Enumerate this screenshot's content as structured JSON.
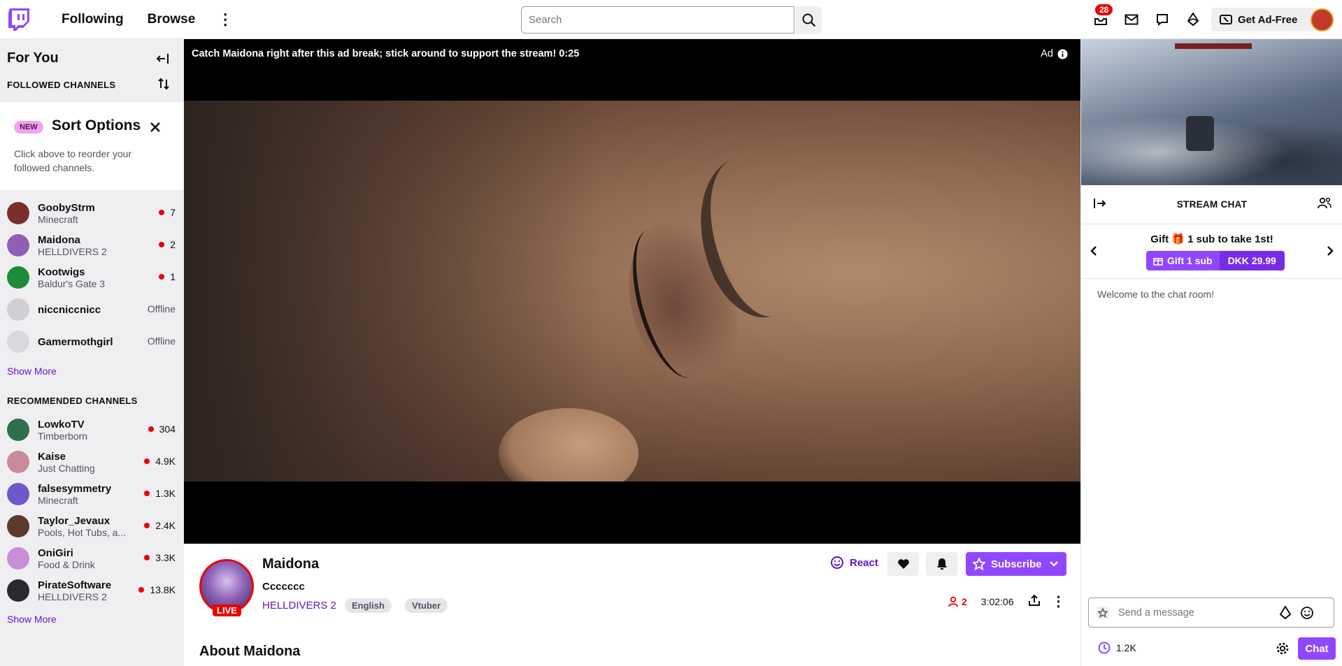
{
  "topnav": {
    "following": "Following",
    "browse": "Browse",
    "search_placeholder": "Search",
    "notifications_count": "28",
    "get_ad_free": "Get Ad-Free"
  },
  "sidebar": {
    "for_you": "For You",
    "followed_channels": "FOLLOWED CHANNELS",
    "sort_card": {
      "badge": "NEW",
      "title": "Sort Options",
      "text": "Click above to reorder your followed channels."
    },
    "followed": [
      {
        "name": "GoobyStrm",
        "game": "Minecraft",
        "viewers": "7",
        "live": true,
        "color": "#7b2d2d"
      },
      {
        "name": "Maidona",
        "game": "HELLDIVERS 2",
        "viewers": "2",
        "live": true,
        "color": "#8e5fb5"
      },
      {
        "name": "Kootwigs",
        "game": "Baldur's Gate 3",
        "viewers": "1",
        "live": true,
        "color": "#1d8b3a"
      },
      {
        "name": "niccniccnicc",
        "game": "",
        "viewers": "Offline",
        "live": false,
        "color": "#cfcfd4"
      },
      {
        "name": "Gamermothgirl",
        "game": "",
        "viewers": "Offline",
        "live": false,
        "color": "#d9d9dd"
      }
    ],
    "show_more": "Show More",
    "recommended_head": "RECOMMENDED CHANNELS",
    "recommended": [
      {
        "name": "LowkoTV",
        "game": "Timberborn",
        "viewers": "304",
        "color": "#2f6e4f"
      },
      {
        "name": "Kaise",
        "game": "Just Chatting",
        "viewers": "4.9K",
        "color": "#c98b9a"
      },
      {
        "name": "falsesymmetry",
        "game": "Minecraft",
        "viewers": "1.3K",
        "color": "#6f56c9"
      },
      {
        "name": "Taylor_Jevaux",
        "game": "Pools, Hot Tubs, a...",
        "viewers": "2.4K",
        "color": "#5a3a2a"
      },
      {
        "name": "OniGiri",
        "game": "Food & Drink",
        "viewers": "3.3K",
        "color": "#c88fd8"
      },
      {
        "name": "PirateSoftware",
        "game": "HELLDIVERS 2",
        "viewers": "13.8K",
        "color": "#2a2a2e"
      }
    ],
    "show_more_2": "Show More"
  },
  "player": {
    "ad_message": "Catch Maidona right after this ad break; stick around to support the stream! 0:25",
    "ad_label": "Ad"
  },
  "stream_info": {
    "channel": "Maidona",
    "live": "LIVE",
    "title": "Ccccccc",
    "game": "HELLDIVERS 2",
    "tags": [
      "English",
      "Vtuber"
    ],
    "react": "React",
    "subscribe": "Subscribe",
    "viewers": "2",
    "uptime": "3:02:06",
    "about": "About Maidona"
  },
  "chat": {
    "header": "STREAM CHAT",
    "gift_prefix": "Gift",
    "gift_suffix": "1 sub to take 1st!",
    "gift_button": "Gift 1 sub",
    "gift_price": "DKK 29.99",
    "welcome": "Welcome to the chat room!",
    "input_placeholder": "Send a message",
    "points": "1.2K",
    "chat_button": "Chat"
  },
  "colors": {
    "brand": "#9147ff",
    "live": "#eb0400",
    "link": "#5c16c5"
  }
}
